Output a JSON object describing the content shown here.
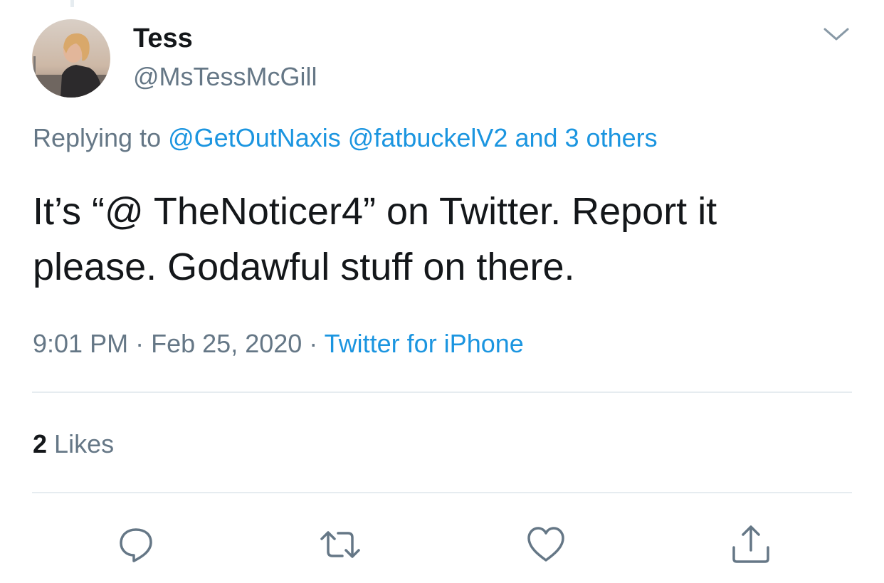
{
  "tweet": {
    "author": {
      "display_name": "Tess",
      "handle": "@MsTessMcGill",
      "avatar_icon": "profile-photo"
    },
    "replying": {
      "prefix": "Replying to",
      "mention_1": "@GetOutNaxis",
      "mention_2": "@fatbuckelV2",
      "others": "and 3 others"
    },
    "text_line_1": "It’s “@ TheNoticer4” on Twitter. Report it",
    "text_line_2": "please. Godawful stuff on there.",
    "time": "9:01 PM",
    "separator": "·",
    "date": "Feb 25, 2020",
    "source": "Twitter for iPhone",
    "likes_count": "2",
    "likes_label": "Likes"
  },
  "actions": [
    {
      "icon": "reply-icon"
    },
    {
      "icon": "retweet-icon"
    },
    {
      "icon": "like-icon"
    },
    {
      "icon": "share-icon"
    }
  ],
  "menu_icon": "chevron-down-icon",
  "colors": {
    "text_primary": "#14171a",
    "text_secondary": "#657786",
    "link": "#1b95e0",
    "divider": "#e6ecf0",
    "icon": "#657786"
  }
}
